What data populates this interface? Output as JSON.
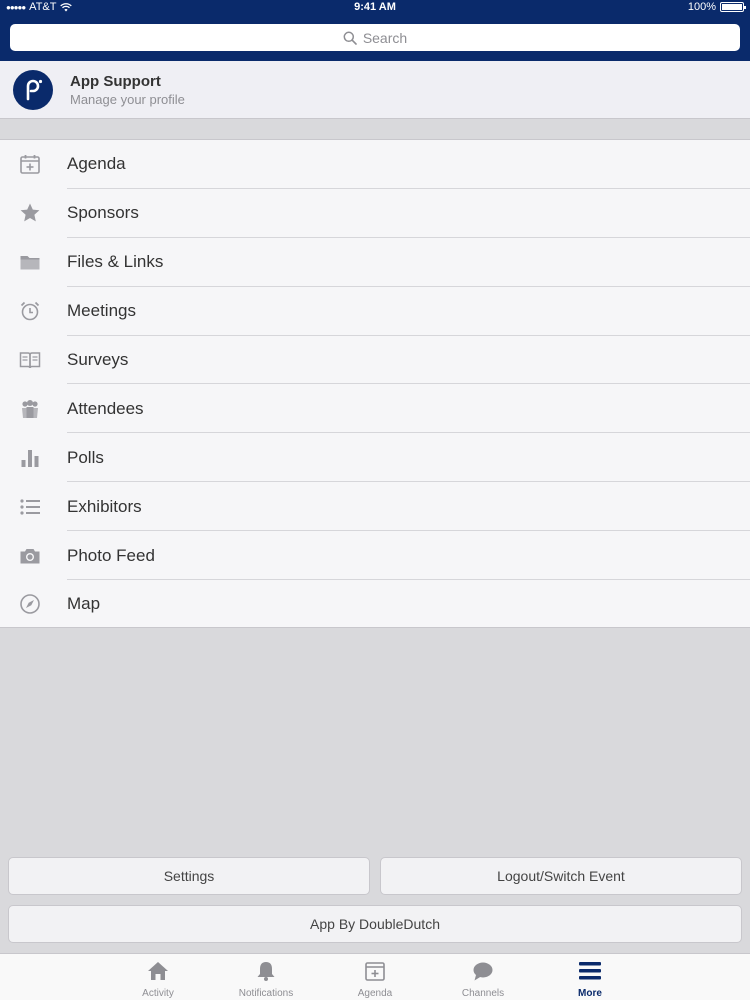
{
  "status_bar": {
    "carrier": "AT&T",
    "time": "9:41 AM",
    "battery": "100%"
  },
  "search": {
    "placeholder": "Search"
  },
  "profile": {
    "title": "App Support",
    "subtitle": "Manage your profile"
  },
  "menu": [
    {
      "label": "Agenda",
      "icon": "calendar-icon"
    },
    {
      "label": "Sponsors",
      "icon": "star-icon"
    },
    {
      "label": "Files & Links",
      "icon": "folder-icon"
    },
    {
      "label": "Meetings",
      "icon": "alarm-clock-icon"
    },
    {
      "label": "Surveys",
      "icon": "book-icon"
    },
    {
      "label": "Attendees",
      "icon": "people-icon"
    },
    {
      "label": "Polls",
      "icon": "bar-chart-icon"
    },
    {
      "label": "Exhibitors",
      "icon": "list-icon"
    },
    {
      "label": "Photo Feed",
      "icon": "camera-icon"
    },
    {
      "label": "Map",
      "icon": "compass-icon"
    }
  ],
  "buttons": {
    "settings": "Settings",
    "logout": "Logout/Switch Event",
    "credit": "App By DoubleDutch"
  },
  "tabs": [
    {
      "label": "Activity",
      "icon": "home-icon"
    },
    {
      "label": "Notifications",
      "icon": "bell-icon"
    },
    {
      "label": "Agenda",
      "icon": "calendar-icon"
    },
    {
      "label": "Channels",
      "icon": "chat-bubble-icon"
    },
    {
      "label": "More",
      "icon": "menu-icon"
    }
  ],
  "colors": {
    "brand": "#0a2a6b",
    "icon_gray": "#9a9aa0",
    "text": "#333333"
  }
}
